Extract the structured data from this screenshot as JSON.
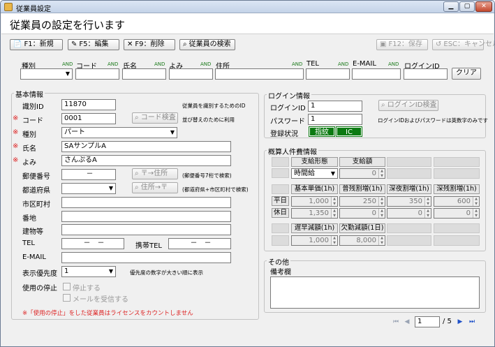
{
  "window": {
    "title": "従業員設定"
  },
  "page": {
    "title": "従業員の設定を行います"
  },
  "toolbar": {
    "new": "F1：新規",
    "edit": "F5：編集",
    "delete": "F9：削除",
    "search": "従業員の検索",
    "save": "F12：保存",
    "cancel": "ESC：キャンセル"
  },
  "search": {
    "type_label": "種別",
    "code_label": "コード",
    "name_label": "氏名",
    "yomi_label": "よみ",
    "address_label": "住所",
    "tel_label": "TEL",
    "email_label": "E-MAIL",
    "login_label": "ログインID",
    "and": "AND",
    "clear": "クリア"
  },
  "basic": {
    "group_title": "基本情報",
    "id_label": "識別ID",
    "id_value": "11870",
    "id_note": "従業員を識別するためのID",
    "code_label": "コード",
    "code_value": "0001",
    "code_check": "コード検査",
    "code_note": "並び替えのために利用",
    "type_label": "種別",
    "type_value": "パート",
    "name_label": "氏名",
    "name_value": "SAサンプルA",
    "yomi_label": "よみ",
    "yomi_value": "さんぷるA",
    "zip_label": "郵便番号",
    "zip_value": "－",
    "zip_btn": "〒→住所",
    "zip_note": "(郵便番号7桁で検索)",
    "pref_label": "都道府県",
    "addr_btn": "住所→〒",
    "addr_note": "(都道府県+市区町村で検索)",
    "city_label": "市区町村",
    "street_label": "番地",
    "building_label": "建物等",
    "tel_label": "TEL",
    "tel_value": "－　－",
    "mobile_label": "携帯TEL",
    "mobile_value": "－　－",
    "email_label": "E-MAIL",
    "priority_label": "表示優先度",
    "priority_value": "1",
    "priority_note": "優先度の数字が大きい順に表示",
    "stop_label": "使用の停止",
    "stop_check": "停止する",
    "mail_check": "メールを受信する",
    "warning": "※「使用の停止」をした従業員はライセンスをカウントしません",
    "req_mark": "※"
  },
  "login": {
    "group_title": "ログイン情報",
    "id_label": "ログインID",
    "id_value": "1",
    "pw_label": "パスワード",
    "pw_value": "1",
    "check_btn": "ログインID検査",
    "note": "ログインIDおよびパスワードは英数字のみです",
    "status_label": "登録状況",
    "status_badge1": "指紋",
    "status_badge2": "IC"
  },
  "cost": {
    "group_title": "概算人件費情報",
    "pay_type_header": "支給形態",
    "pay_amount_header": "支給額",
    "pay_type_value": "時間給",
    "pay_amount_value": "0",
    "headers": [
      "基本単価(1h)",
      "普残割増(1h)",
      "深夜割増(1h)",
      "深残割増(1h)"
    ],
    "row_weekday": "平日",
    "row_holiday": "休日",
    "weekday": [
      "1,000",
      "250",
      "350",
      "600"
    ],
    "holiday": [
      "1,350",
      "0",
      "0",
      "0"
    ],
    "late_header": "遅早減額(1h)",
    "absent_header": "欠勤減額(1日)",
    "late_value": "1,000",
    "absent_value": "8,000"
  },
  "other": {
    "group_title": "その他",
    "memo_label": "備考欄"
  },
  "pager": {
    "page": "1",
    "total": "/ 5"
  }
}
